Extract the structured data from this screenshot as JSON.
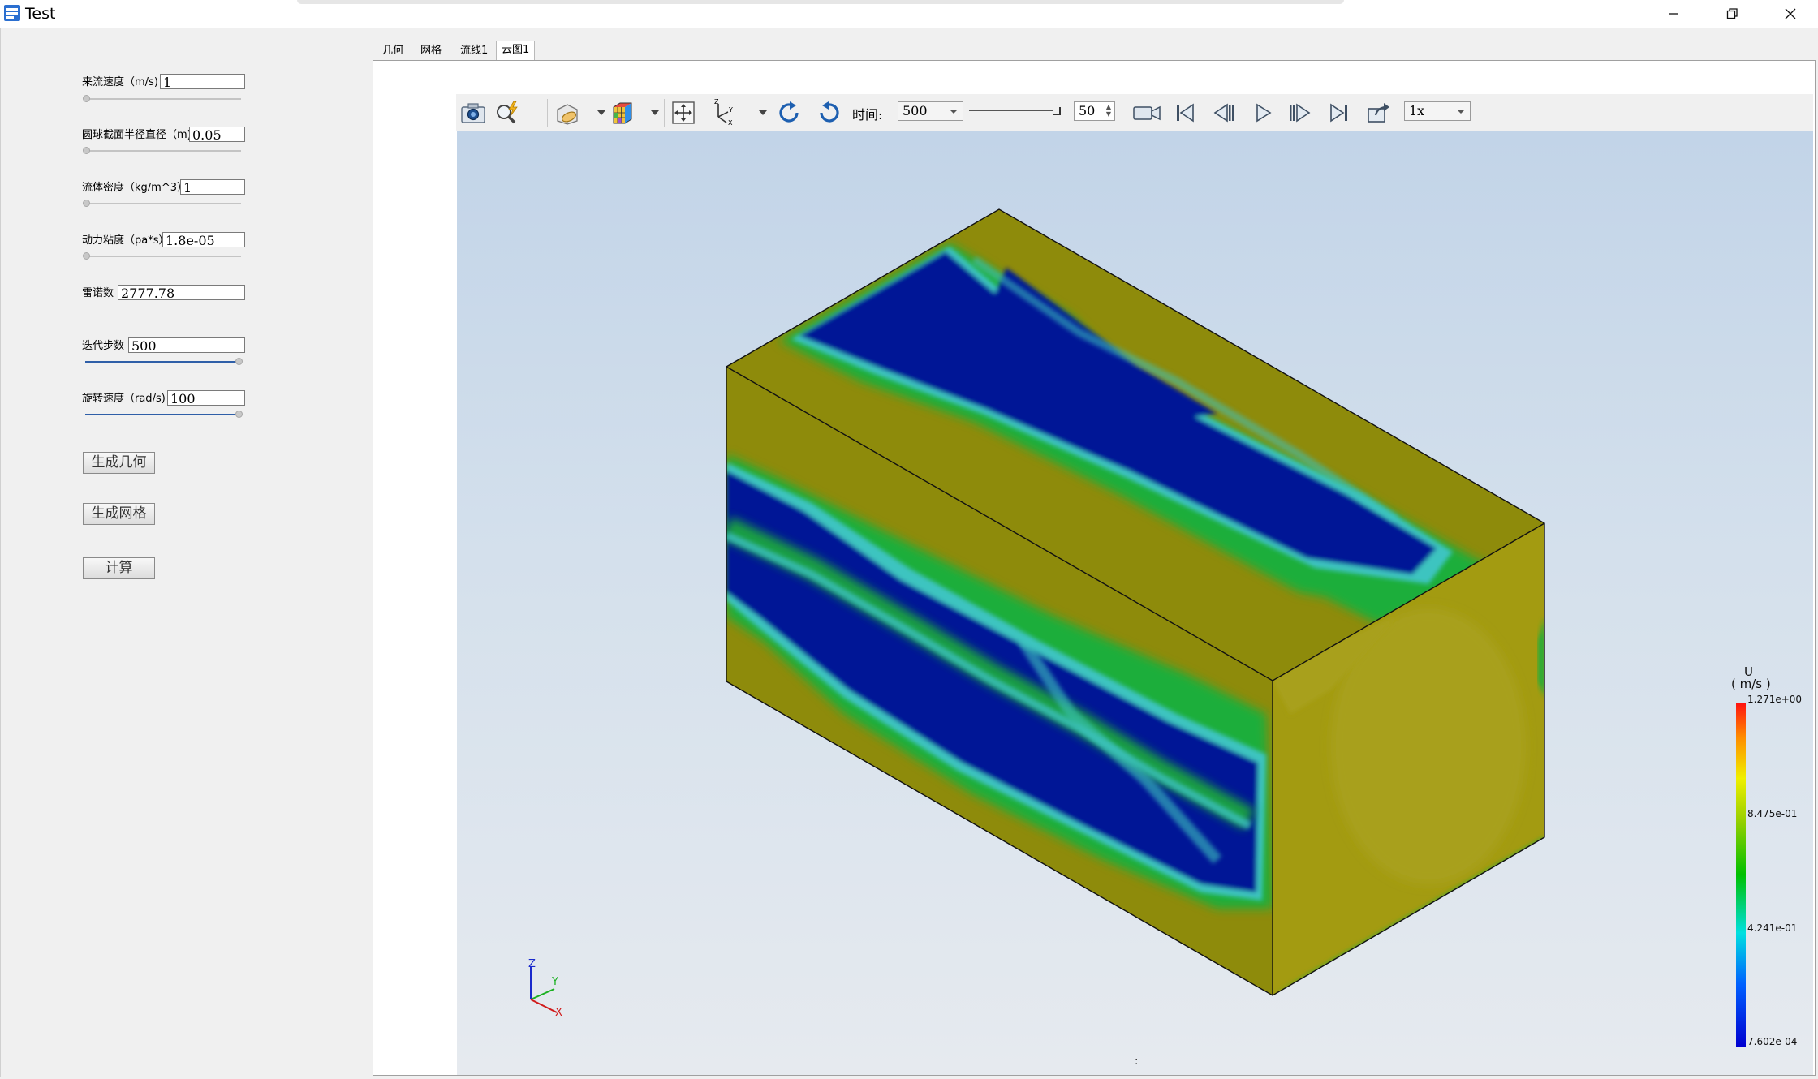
{
  "window": {
    "title": "Test",
    "minimize_icon": "minimize-icon",
    "maximize_icon": "restore-icon",
    "close_icon": "close-icon"
  },
  "params": [
    {
      "label": "来流速度（m/s)",
      "value": "1",
      "slider": 0.0
    },
    {
      "label": "圆球截面半径直径（m)",
      "value": "0.05",
      "slider": 0.0
    },
    {
      "label": "流体密度（kg/m^3）",
      "value": "1",
      "slider": 0.0
    },
    {
      "label": "动力粘度（pa*s）",
      "value": "1.8e-05",
      "slider": 0.0
    },
    {
      "label": "雷诺数",
      "value": "2777.78"
    },
    {
      "label": "迭代步数",
      "value": "500",
      "slider": 1.0
    },
    {
      "label": "旋转速度（rad/s)",
      "value": "100",
      "slider": 1.0
    }
  ],
  "buttons": {
    "gen_geometry": "生成几何",
    "gen_mesh": "生成网格",
    "compute": "计算"
  },
  "tabs": [
    "几何",
    "网格",
    "流线1",
    "云图1"
  ],
  "active_tab": "云图1",
  "toolbar": {
    "time_label": "时间:",
    "time_value": "500",
    "frame_value": "50",
    "speed_value": "1x",
    "icons": [
      "camera-icon",
      "zoom-icon",
      "clip-plane-icon",
      "color-cube-icon",
      "fit-view-icon",
      "axes-icon",
      "rotate-cw-icon",
      "rotate-ccw-icon",
      "record-icon",
      "first-frame-icon",
      "prev-frame-icon",
      "play-icon",
      "next-frame-icon",
      "last-frame-icon",
      "export-icon"
    ]
  },
  "colorbar": {
    "title": "U",
    "unit": "( m/s )",
    "ticks": [
      "1.271e+00",
      "8.475e-01",
      "4.241e-01",
      "7.602e-04"
    ]
  },
  "axes": {
    "z": "Z",
    "y": "Y",
    "x": "X"
  },
  "status_mark": ":",
  "colors": {
    "field_high": "#8b8a05",
    "field_low": "#001496",
    "field_mid": "#18b02a",
    "field_cyan": "#34c6c0"
  }
}
